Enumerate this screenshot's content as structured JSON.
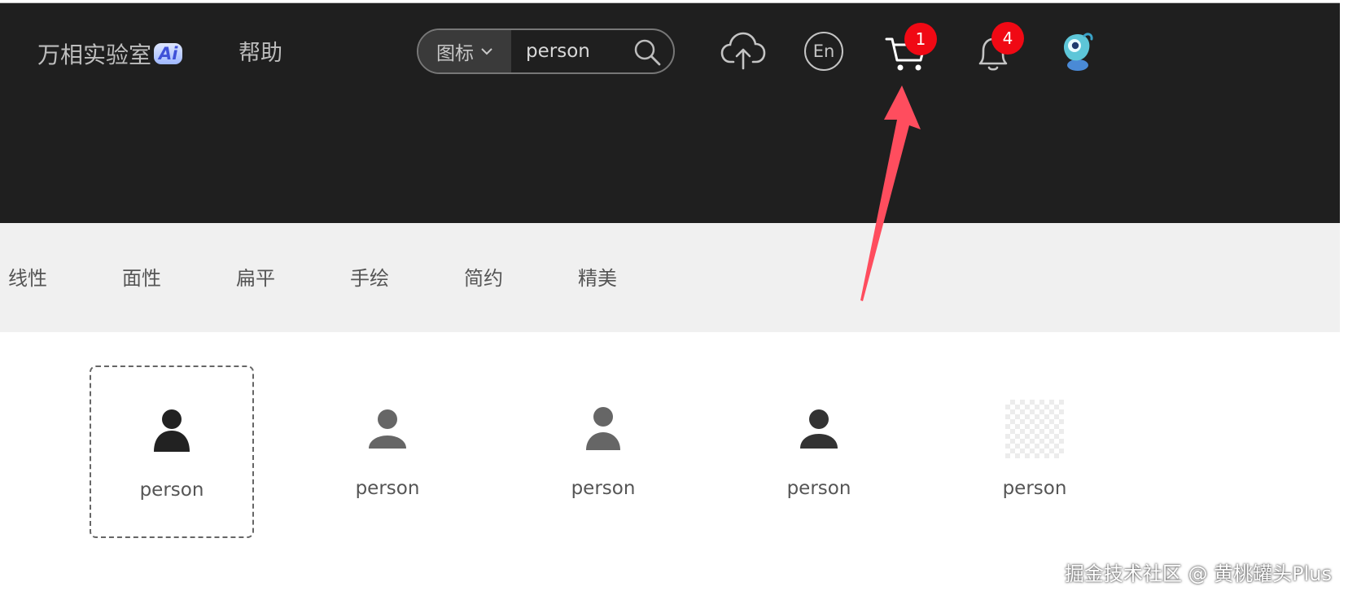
{
  "header": {
    "brand": "万相实验室",
    "brand_badge": "Ai",
    "help": "帮助",
    "search": {
      "type_label": "图标",
      "value": "person"
    },
    "icons": {
      "upload": "cloud-upload-icon",
      "language": "En",
      "cart_count": "1",
      "notification_count": "4",
      "avatar": "avatar"
    },
    "colors": {
      "background": "#1f1f1f",
      "badge": "#f00914"
    }
  },
  "filters": [
    "线性",
    "面性",
    "扁平",
    "手绘",
    "简约",
    "精美"
  ],
  "results": [
    {
      "name": "person",
      "style": "filled-dark",
      "selected": true
    },
    {
      "name": "person",
      "style": "filled-gray",
      "selected": false
    },
    {
      "name": "person",
      "style": "filled-gray",
      "selected": false
    },
    {
      "name": "person",
      "style": "filled-dark",
      "selected": false
    },
    {
      "name": "person",
      "style": "transparent-placeholder",
      "selected": false
    }
  ],
  "annotation": {
    "arrow_color": "#ff4d5e",
    "points_to": "cart-icon"
  },
  "watermark": "掘金技术社区 @ 黄桃罐头Plus"
}
